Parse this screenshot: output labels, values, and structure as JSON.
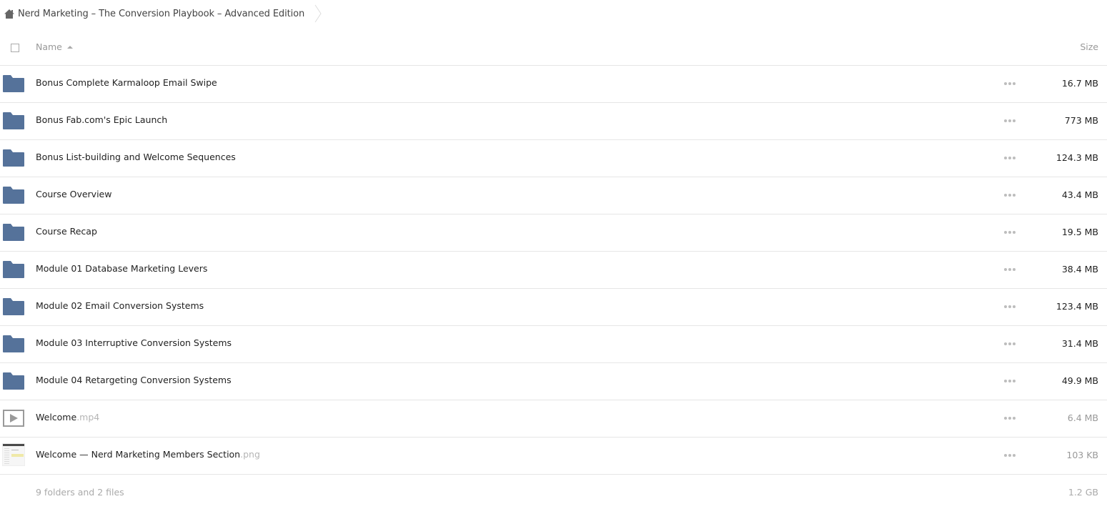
{
  "breadcrumb": {
    "home_icon": "home-icon",
    "title": "Nerd Marketing – The Conversion Playbook – Advanced Edition",
    "chevron_icon": "chevron-right-icon"
  },
  "header": {
    "select_all_icon": "checkbox-icon",
    "name_label": "Name",
    "sort_icon": "sort-ascending-icon",
    "size_label": "Size"
  },
  "items": [
    {
      "type": "folder",
      "icon": "folder-icon",
      "name": "Bonus Complete Karmaloop Email Swipe",
      "ext": "",
      "size": "16.7 MB"
    },
    {
      "type": "folder",
      "icon": "folder-icon",
      "name": "Bonus Fab.com's Epic Launch",
      "ext": "",
      "size": "773 MB"
    },
    {
      "type": "folder",
      "icon": "folder-icon",
      "name": "Bonus List-building and Welcome Sequences",
      "ext": "",
      "size": "124.3 MB"
    },
    {
      "type": "folder",
      "icon": "folder-icon",
      "name": "Course Overview",
      "ext": "",
      "size": "43.4 MB"
    },
    {
      "type": "folder",
      "icon": "folder-icon",
      "name": "Course Recap",
      "ext": "",
      "size": "19.5 MB"
    },
    {
      "type": "folder",
      "icon": "folder-icon",
      "name": "Module 01 Database Marketing Levers",
      "ext": "",
      "size": "38.4 MB"
    },
    {
      "type": "folder",
      "icon": "folder-icon",
      "name": "Module 02 Email Conversion Systems",
      "ext": "",
      "size": "123.4 MB"
    },
    {
      "type": "folder",
      "icon": "folder-icon",
      "name": "Module 03 Interruptive Conversion Systems",
      "ext": "",
      "size": "31.4 MB"
    },
    {
      "type": "folder",
      "icon": "folder-icon",
      "name": "Module 04 Retargeting Conversion Systems",
      "ext": "",
      "size": "49.9 MB"
    },
    {
      "type": "file",
      "icon": "video-play-icon",
      "name": "Welcome",
      "ext": ".mp4",
      "size": "6.4 MB"
    },
    {
      "type": "file",
      "icon": "image-thumbnail-icon",
      "name": "Welcome — Nerd Marketing Members Section",
      "ext": ".png",
      "size": "103 KB"
    }
  ],
  "more_icon": "more-options-icon",
  "footer": {
    "count": "9 folders and 2 files",
    "total_size": "1.2 GB"
  },
  "colors": {
    "folder": "#55729a",
    "text": "#222222",
    "muted": "#999999",
    "divider": "#e6e6e6"
  }
}
